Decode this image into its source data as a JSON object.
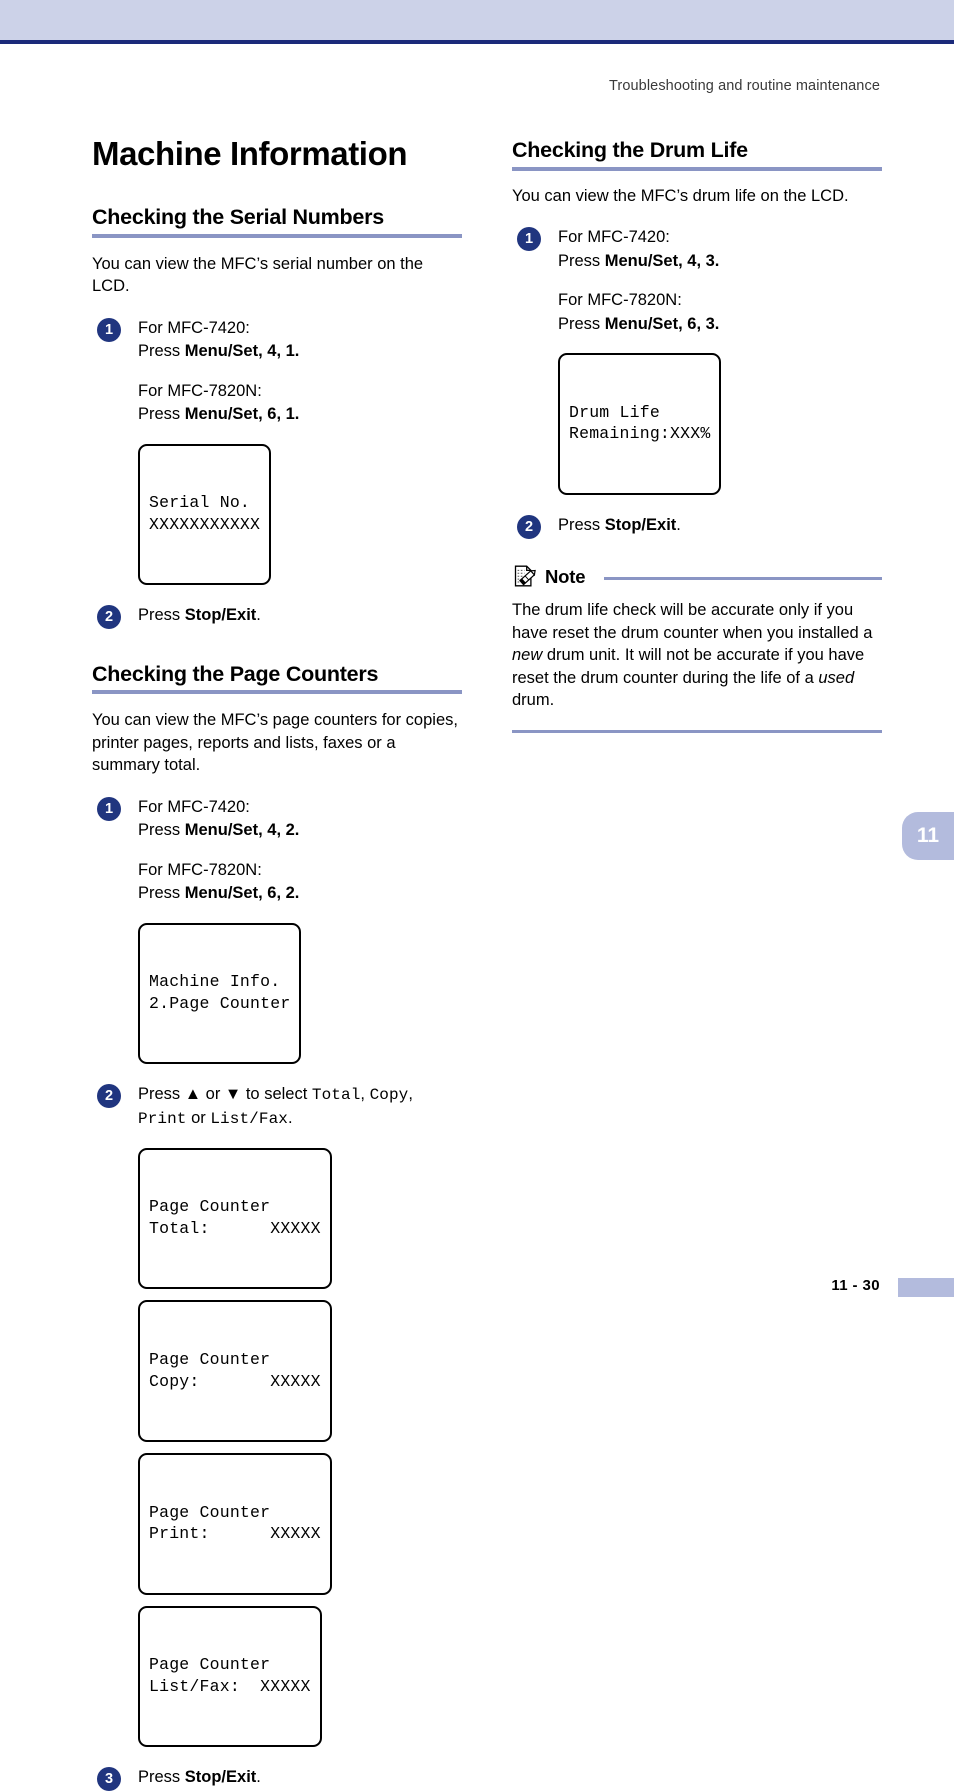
{
  "header": {
    "running_head": "Troubleshooting and routine maintenance"
  },
  "colors": {
    "top_band": "#ccd2e8",
    "top_band_line": "#1b2a7a",
    "heading_rule": "#8a95c4",
    "step_bullet": "#20357f",
    "tab": "#b3bbdd"
  },
  "left_column": {
    "chapter_title": "Machine Information",
    "serial": {
      "heading": "Checking the Serial Numbers",
      "intro": "You can view the MFC’s serial number on the LCD.",
      "steps": [
        {
          "number": "1",
          "line1_model": "For MFC-7420:",
          "line1_press_prefix": "Press ",
          "line1_key": "Menu/Set",
          "line1_args": ", 4, 1.",
          "line2_model": "For MFC-7820N:",
          "line2_press_prefix": "Press ",
          "line2_key": "Menu/Set",
          "line2_args": ", 6, 1."
        },
        {
          "number": "2",
          "press_prefix": "Press ",
          "key": "Stop/Exit",
          "suffix": "."
        }
      ],
      "lcd": {
        "line1": "Serial No.",
        "line2": "XXXXXXXXXXX"
      }
    },
    "page_counters": {
      "heading": "Checking the Page Counters",
      "intro": "You can view the MFC’s page counters for copies, printer pages, reports and lists, faxes or a summary total.",
      "step1": {
        "number": "1",
        "line1_model": "For MFC-7420:",
        "line1_press_prefix": "Press ",
        "line1_key": "Menu/Set",
        "line1_args": ", 4, 2.",
        "line2_model": "For MFC-7820N:",
        "line2_press_prefix": "Press ",
        "line2_key": "Menu/Set",
        "line2_args": ", 6, 2."
      },
      "lcd_menu": {
        "line1": "Machine Info.",
        "line2": "2.Page Counter"
      },
      "step2": {
        "number": "2",
        "text_a": "Press ▲ or ▼ to select ",
        "mono_a": "Total",
        "text_b": ", ",
        "mono_b": "Copy",
        "text_c": ", ",
        "mono_c": "Print",
        "text_d": " or ",
        "mono_d": "List/Fax",
        "text_e": "."
      },
      "lcd_counters": [
        {
          "line1": "Page Counter",
          "line2": "Total:      XXXXX"
        },
        {
          "line1": "Page Counter",
          "line2": "Copy:       XXXXX"
        },
        {
          "line1": "Page Counter",
          "line2": "Print:      XXXXX"
        },
        {
          "line1": "Page Counter",
          "line2": "List/Fax:  XXXXX"
        }
      ],
      "step3": {
        "number": "3",
        "press_prefix": "Press ",
        "key": "Stop/Exit",
        "suffix": "."
      }
    }
  },
  "right_column": {
    "drum": {
      "heading": "Checking the Drum Life",
      "intro": "You can view the MFC’s drum life on the LCD.",
      "step1": {
        "number": "1",
        "line1_model": "For MFC-7420:",
        "line1_press_prefix": "Press ",
        "line1_key": "Menu/Set",
        "line1_args": ", 4, 3.",
        "line2_model": "For MFC-7820N:",
        "line2_press_prefix": "Press ",
        "line2_key": "Menu/Set",
        "line2_args": ", 6, 3."
      },
      "lcd": {
        "line1": "Drum Life",
        "line2": "Remaining:XXX%"
      },
      "step2": {
        "number": "2",
        "press_prefix": "Press ",
        "key": "Stop/Exit",
        "suffix": "."
      }
    },
    "note": {
      "label": "Note",
      "icon": "note-pencil-icon",
      "text_a": "The drum life check will be accurate only if you have reset the drum counter when you installed a ",
      "em_a": "new",
      "text_b": " drum unit. It will not be accurate if you have reset the drum counter during the life of a ",
      "em_b": "used",
      "text_c": " drum."
    }
  },
  "chapter_tab": {
    "number": "11"
  },
  "footer": {
    "page_number": "11 - 30"
  }
}
